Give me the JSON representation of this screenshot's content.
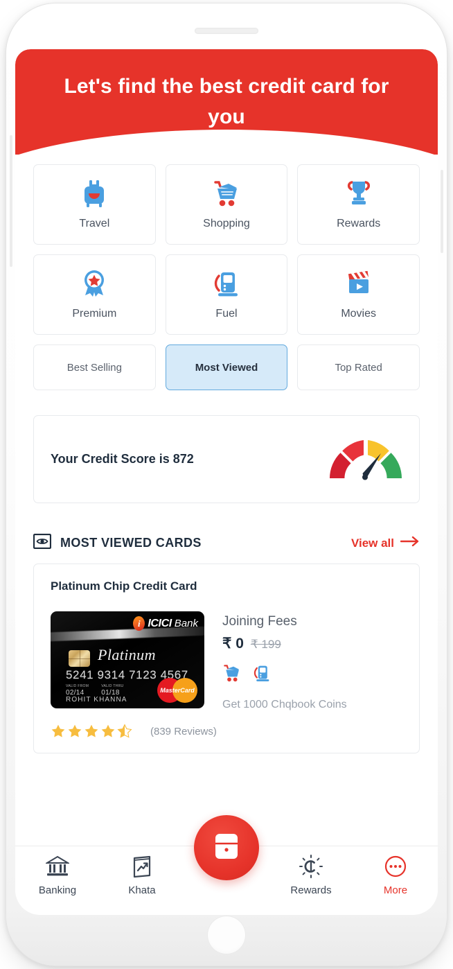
{
  "header": {
    "title": "Let's find the best credit card for you"
  },
  "categories": [
    {
      "label": "Travel",
      "icon": "suitcase-icon"
    },
    {
      "label": "Shopping",
      "icon": "shopping-cart-icon"
    },
    {
      "label": "Rewards",
      "icon": "trophy-icon"
    },
    {
      "label": "Premium",
      "icon": "star-badge-icon"
    },
    {
      "label": "Fuel",
      "icon": "fuel-pump-icon"
    },
    {
      "label": "Movies",
      "icon": "clapperboard-icon"
    }
  ],
  "filters": [
    {
      "label": "Best Selling",
      "active": false
    },
    {
      "label": "Most Viewed",
      "active": true
    },
    {
      "label": "Top Rated",
      "active": false
    }
  ],
  "credit_score": {
    "text": "Your Credit Score is 872",
    "value": 872,
    "gauge_icon": "speedometer-gauge-icon",
    "segment_colors": [
      "#D32030",
      "#E8333A",
      "#F8C32C",
      "#35A95B"
    ]
  },
  "section": {
    "icon": "eye-icon",
    "title": "MOST VIEWED  CARDS",
    "view_all_label": "View all",
    "view_all_icon": "arrow-right-icon"
  },
  "product": {
    "title": "Platinum Chip Credit Card",
    "card_art": {
      "bank_name": "ICICI",
      "bank_suffix": "Bank",
      "tier": "Platinum",
      "number": "5241 9314 7123 4567",
      "valid_from_label": "VALID FROM",
      "valid_from": "02/14",
      "valid_thru_label": "VALID THRU",
      "valid_thru": "01/18",
      "holder": "ROHIT KHANNA",
      "network": "MasterCard"
    },
    "fees_label": "Joining Fees",
    "fees_current": "₹ 0",
    "fees_original": "₹ 199",
    "benefit_icons": [
      "shopping-cart-icon",
      "fuel-pump-icon"
    ],
    "offer_note": "Get 1000 Chqbook Coins",
    "rating": 4.5,
    "reviews_label": "(839 Reviews)"
  },
  "bottom_nav": {
    "items": [
      {
        "label": "Banking",
        "icon": "bank-icon",
        "active": false
      },
      {
        "label": "Khata",
        "icon": "ledger-icon",
        "active": false
      },
      {
        "label": "Rewards",
        "icon": "coin-sun-icon",
        "active": false
      },
      {
        "label": "More",
        "icon": "more-dots-icon",
        "active": true
      }
    ],
    "fab_icon": "wallet-icon"
  },
  "theme": {
    "brand_red": "#E6332A",
    "icon_blue": "#4a9fe0",
    "text_navy": "#1f2d3d"
  }
}
